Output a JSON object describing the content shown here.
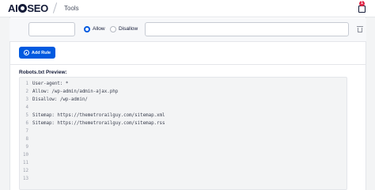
{
  "header": {
    "logo_text": "AIOSEO",
    "page_label": "Tools",
    "notification_count": "1"
  },
  "rule_row": {
    "allow_label": "Allow",
    "disallow_label": "Disallow",
    "selected": "Allow"
  },
  "add_rule_label": "Add Rule",
  "preview": {
    "title": "Robots.txt Preview:",
    "lines": [
      {
        "n": "1",
        "text": "User-agent: *"
      },
      {
        "n": "2",
        "text": "Allow: /wp-admin/admin-ajax.php"
      },
      {
        "n": "3",
        "text": "Disallow: /wp-admin/"
      },
      {
        "n": "4",
        "text": ""
      },
      {
        "n": "5",
        "text": "Sitemap: https://themetrorailguy.com/sitemap.xml"
      },
      {
        "n": "6",
        "text": "Sitemap: https://themetrorailguy.com/sitemap.rss"
      },
      {
        "n": "7",
        "text": ""
      },
      {
        "n": "8",
        "text": ""
      },
      {
        "n": "9",
        "text": ""
      },
      {
        "n": "10",
        "text": ""
      },
      {
        "n": "11",
        "text": ""
      },
      {
        "n": "12",
        "text": ""
      },
      {
        "n": "13",
        "text": ""
      }
    ]
  },
  "colors": {
    "accent": "#005ae0",
    "badge": "#df2a4a",
    "text_dark": "#141b38"
  }
}
